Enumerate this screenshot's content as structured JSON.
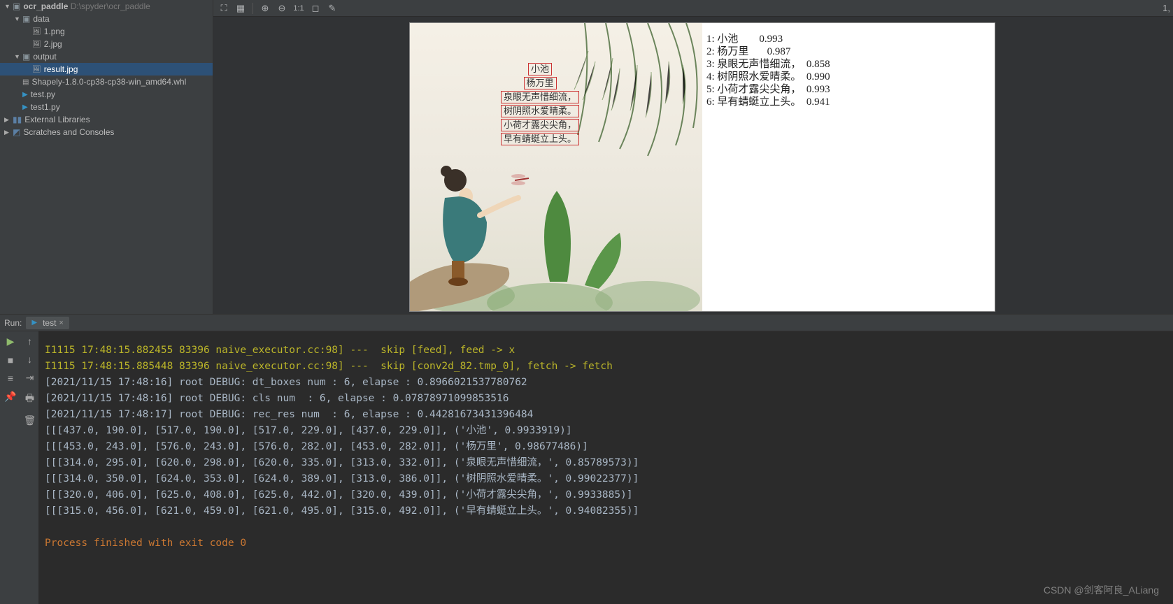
{
  "project": {
    "root_name": "ocr_paddle",
    "root_path": "D:\\spyder\\ocr_paddle",
    "tree": [
      {
        "name": "data",
        "type": "dir",
        "indent": 1,
        "expanded": true
      },
      {
        "name": "1.png",
        "type": "img",
        "indent": 2
      },
      {
        "name": "2.jpg",
        "type": "img",
        "indent": 2
      },
      {
        "name": "output",
        "type": "dir",
        "indent": 1,
        "expanded": true
      },
      {
        "name": "result.jpg",
        "type": "img",
        "indent": 2,
        "selected": true
      },
      {
        "name": "Shapely-1.8.0-cp38-cp38-win_amd64.whl",
        "type": "file",
        "indent": 1
      },
      {
        "name": "test.py",
        "type": "py",
        "indent": 1
      },
      {
        "name": "test1.py",
        "type": "py",
        "indent": 1
      }
    ],
    "external_libs": "External Libraries",
    "scratches": "Scratches and Consoles"
  },
  "toolbar": {
    "ratio": "1:1"
  },
  "poem": {
    "lines": [
      "小池",
      "杨万里",
      "泉眼无声惜细流，",
      "树阴照水爱晴柔。",
      "小荷才露尖尖角，",
      "早有蜻蜓立上头。"
    ]
  },
  "ocr": {
    "rows": [
      {
        "idx": "1:",
        "text": "小池",
        "conf": "0.993"
      },
      {
        "idx": "2:",
        "text": "杨万里",
        "conf": "0.987"
      },
      {
        "idx": "3:",
        "text": "泉眼无声惜细流，",
        "conf": "0.858"
      },
      {
        "idx": "4:",
        "text": "树阴照水爱晴柔。",
        "conf": "0.990"
      },
      {
        "idx": "5:",
        "text": "小荷才露尖尖角，",
        "conf": "0.993"
      },
      {
        "idx": "6:",
        "text": "早有蜻蜓立上头。",
        "conf": "0.941"
      }
    ]
  },
  "run": {
    "label": "Run:",
    "tab_name": "test"
  },
  "console_lines": [
    {
      "cls": "c-yellow2",
      "text": "I1115 17:48:15.882455 83396 naive_executor.cc:98] ---  skip [feed], feed -> x"
    },
    {
      "cls": "c-yellow2",
      "text": "I1115 17:48:15.885448 83396 naive_executor.cc:98] ---  skip [conv2d_82.tmp_0], fetch -> fetch"
    },
    {
      "cls": "",
      "text": "[2021/11/15 17:48:16] root DEBUG: dt_boxes num : 6, elapse : 0.8966021537780762"
    },
    {
      "cls": "",
      "text": "[2021/11/15 17:48:16] root DEBUG: cls num  : 6, elapse : 0.07878971099853516"
    },
    {
      "cls": "",
      "text": "[2021/11/15 17:48:17] root DEBUG: rec_res num  : 6, elapse : 0.44281673431396484"
    },
    {
      "cls": "",
      "text": "[[[437.0, 190.0], [517.0, 190.0], [517.0, 229.0], [437.0, 229.0]], ('小池', 0.9933919)]"
    },
    {
      "cls": "",
      "text": "[[[453.0, 243.0], [576.0, 243.0], [576.0, 282.0], [453.0, 282.0]], ('杨万里', 0.98677486)]"
    },
    {
      "cls": "",
      "text": "[[[314.0, 295.0], [620.0, 298.0], [620.0, 335.0], [313.0, 332.0]], ('泉眼无声惜细流，', 0.85789573)]"
    },
    {
      "cls": "",
      "text": "[[[314.0, 350.0], [624.0, 353.0], [624.0, 389.0], [313.0, 386.0]], ('树阴照水爱晴柔。', 0.99022377)]"
    },
    {
      "cls": "",
      "text": "[[[320.0, 406.0], [625.0, 408.0], [625.0, 442.0], [320.0, 439.0]], ('小荷才露尖尖角，', 0.9933885)]"
    },
    {
      "cls": "",
      "text": "[[[315.0, 456.0], [621.0, 459.0], [621.0, 495.0], [315.0, 492.0]], ('早有蜻蜓立上头。', 0.94082355)]"
    },
    {
      "cls": "",
      "text": ""
    },
    {
      "cls": "c-yellow",
      "text": "Process finished with exit code 0"
    }
  ],
  "watermark": "CSDN @剑客阿良_ALiang",
  "status_right": "1,"
}
